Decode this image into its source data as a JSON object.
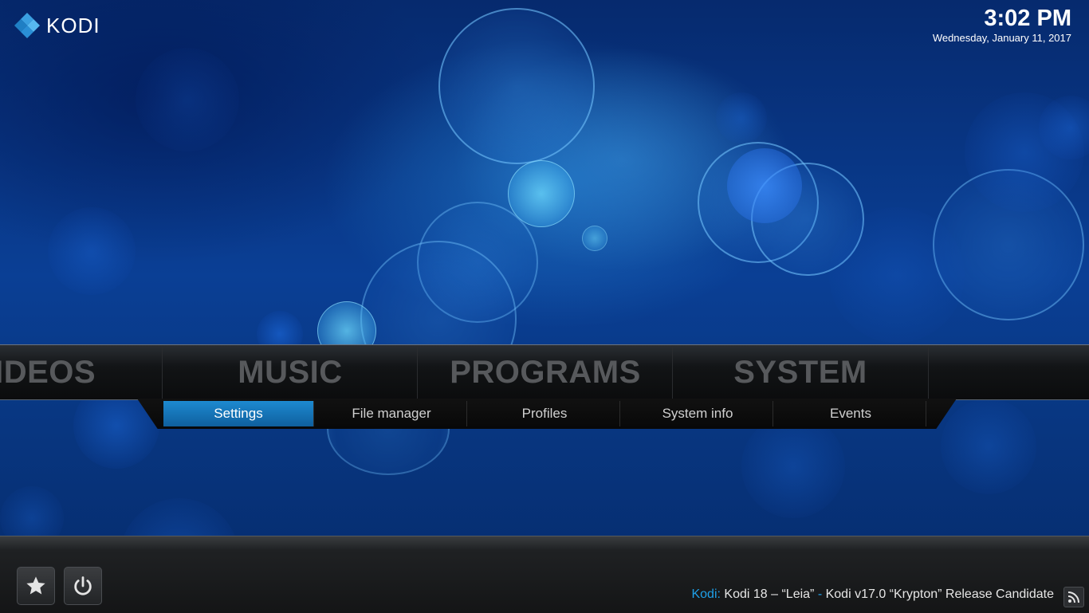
{
  "app": {
    "logo_text": "KODI"
  },
  "clock": {
    "time": "3:02 PM",
    "date": "Wednesday, January 11, 2017"
  },
  "main_menu": {
    "items": [
      {
        "label": "VIDEOS"
      },
      {
        "label": "MUSIC"
      },
      {
        "label": "PROGRAMS"
      },
      {
        "label": "SYSTEM"
      }
    ]
  },
  "sub_menu": {
    "items": [
      {
        "label": "Settings",
        "active": true
      },
      {
        "label": "File manager"
      },
      {
        "label": "Profiles"
      },
      {
        "label": "System info"
      },
      {
        "label": "Events"
      }
    ]
  },
  "footer": {
    "favourites_icon": "star-icon",
    "power_icon": "power-icon",
    "ticker": {
      "source": "Kodi:",
      "headline_1": "Kodi 18 – “Leia”",
      "separator": "-",
      "headline_2": "Kodi v17.0 “Krypton” Release Candidate"
    },
    "rss_icon": "rss-icon"
  },
  "colors": {
    "accent": "#1fa0e8",
    "active_tab": "#1d8ad0",
    "menu_text_inactive": "#57595c"
  }
}
